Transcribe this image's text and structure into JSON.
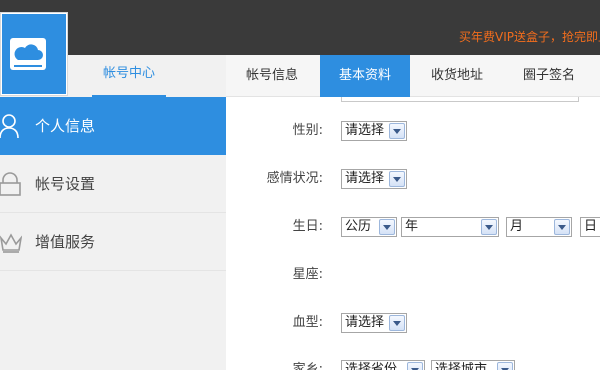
{
  "header": {
    "promo_text": "买年费VIP送盒子，抢完即止"
  },
  "logo": {
    "icon": "cloud-icon",
    "color": "#2e8ee0"
  },
  "left_header": {
    "label": "帐号中心"
  },
  "tabs": [
    {
      "label": "帐号信息",
      "active": false
    },
    {
      "label": "基本资料",
      "active": true
    },
    {
      "label": "收货地址",
      "active": false
    },
    {
      "label": "圈子签名",
      "active": false
    }
  ],
  "sidebar": {
    "items": [
      {
        "label": "个人信息",
        "icon": "user-icon",
        "active": true
      },
      {
        "label": "帐号设置",
        "icon": "lock-icon",
        "active": false
      },
      {
        "label": "增值服务",
        "icon": "crown-icon",
        "active": false
      }
    ]
  },
  "form": {
    "gender": {
      "label": "性别:",
      "value": "请选择"
    },
    "relationship": {
      "label": "感情状况:",
      "value": "请选择"
    },
    "birthday": {
      "label": "生日:",
      "calendar": "公历",
      "year": "年",
      "month": "月",
      "day": "日"
    },
    "zodiac": {
      "label": "星座:"
    },
    "blood_type": {
      "label": "血型:",
      "value": "请选择"
    },
    "hometown": {
      "label": "家乡:",
      "province": "选择省份",
      "city": "选择城市"
    }
  },
  "colors": {
    "accent": "#2e8ee0",
    "topbar": "#3a3a3a",
    "promo": "#f26d1d"
  }
}
